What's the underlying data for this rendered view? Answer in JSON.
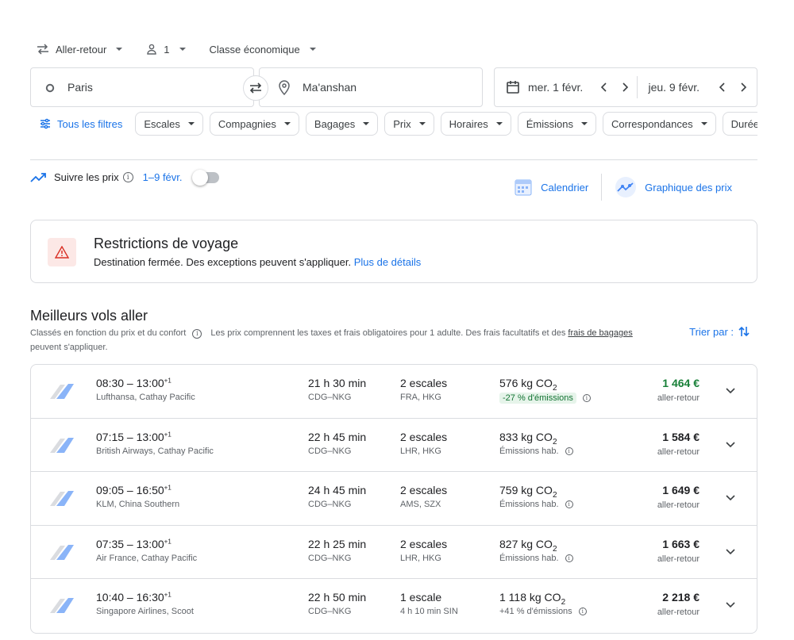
{
  "top": {
    "trip_type": "Aller-retour",
    "passengers": "1",
    "cabin": "Classe économique"
  },
  "search": {
    "origin": "Paris",
    "destination": "Ma'anshan",
    "depart_date": "mer. 1 févr.",
    "return_date": "jeu. 9 févr."
  },
  "filters": {
    "all_label": "Tous les filtres",
    "chips": [
      "Escales",
      "Compagnies",
      "Bagages",
      "Prix",
      "Horaires",
      "Émissions",
      "Correspondances",
      "Durée"
    ]
  },
  "track": {
    "label": "Suivre les prix",
    "range": "1–9 févr."
  },
  "actions": {
    "calendar": "Calendrier",
    "price_graph": "Graphique des prix"
  },
  "restrictions": {
    "title": "Restrictions de voyage",
    "desc": "Destination fermée. Des exceptions peuvent s'appliquer.",
    "link": "Plus de détails"
  },
  "best": {
    "title": "Meilleurs vols aller",
    "ranked": "Classés en fonction du prix et du confort",
    "note_before": "Les prix comprennent les taxes et frais obligatoires pour 1 adulte. Des frais facultatifs et des",
    "note_link": "frais de bagages",
    "note_after": "peuvent s'appliquer.",
    "sort_label": "Trier par :"
  },
  "flights": [
    {
      "depart": "08:30",
      "arrive": "13:00",
      "plus": "+1",
      "airlines": "Lufthansa, Cathay Pacific",
      "duration": "21 h 30 min",
      "route": "CDG–NKG",
      "stops": "2 escales",
      "stop_codes": "FRA, HKG",
      "co2": "576 kg CO",
      "emissions": "-27 % d'émissions",
      "emis_good": true,
      "price": "1 464 €",
      "cheap": true,
      "price_type": "aller-retour"
    },
    {
      "depart": "07:15",
      "arrive": "13:00",
      "plus": "+1",
      "airlines": "British Airways, Cathay Pacific",
      "duration": "22 h 45 min",
      "route": "CDG–NKG",
      "stops": "2 escales",
      "stop_codes": "LHR, HKG",
      "co2": "833 kg CO",
      "emissions": "Émissions hab.",
      "emis_good": false,
      "price": "1 584 €",
      "cheap": false,
      "price_type": "aller-retour"
    },
    {
      "depart": "09:05",
      "arrive": "16:50",
      "plus": "+1",
      "airlines": "KLM, China Southern",
      "duration": "24 h 45 min",
      "route": "CDG–NKG",
      "stops": "2 escales",
      "stop_codes": "AMS, SZX",
      "co2": "759 kg CO",
      "emissions": "Émissions hab.",
      "emis_good": false,
      "price": "1 649 €",
      "cheap": false,
      "price_type": "aller-retour"
    },
    {
      "depart": "07:35",
      "arrive": "13:00",
      "plus": "+1",
      "airlines": "Air France, Cathay Pacific",
      "duration": "22 h 25 min",
      "route": "CDG–NKG",
      "stops": "2 escales",
      "stop_codes": "LHR, HKG",
      "co2": "827 kg CO",
      "emissions": "Émissions hab.",
      "emis_good": false,
      "price": "1 663 €",
      "cheap": false,
      "price_type": "aller-retour"
    },
    {
      "depart": "10:40",
      "arrive": "16:30",
      "plus": "+1",
      "airlines": "Singapore Airlines, Scoot",
      "duration": "22 h 50 min",
      "route": "CDG–NKG",
      "stops": "1 escale",
      "stop_codes": "4 h 10 min SIN",
      "co2": "1 118 kg CO",
      "emissions": "+41 % d'émissions",
      "emis_good": false,
      "price": "2 218 €",
      "cheap": false,
      "price_type": "aller-retour"
    }
  ],
  "colors": {
    "accent": "#1a73e8",
    "cheap": "#188038",
    "warn": "#d93025"
  }
}
